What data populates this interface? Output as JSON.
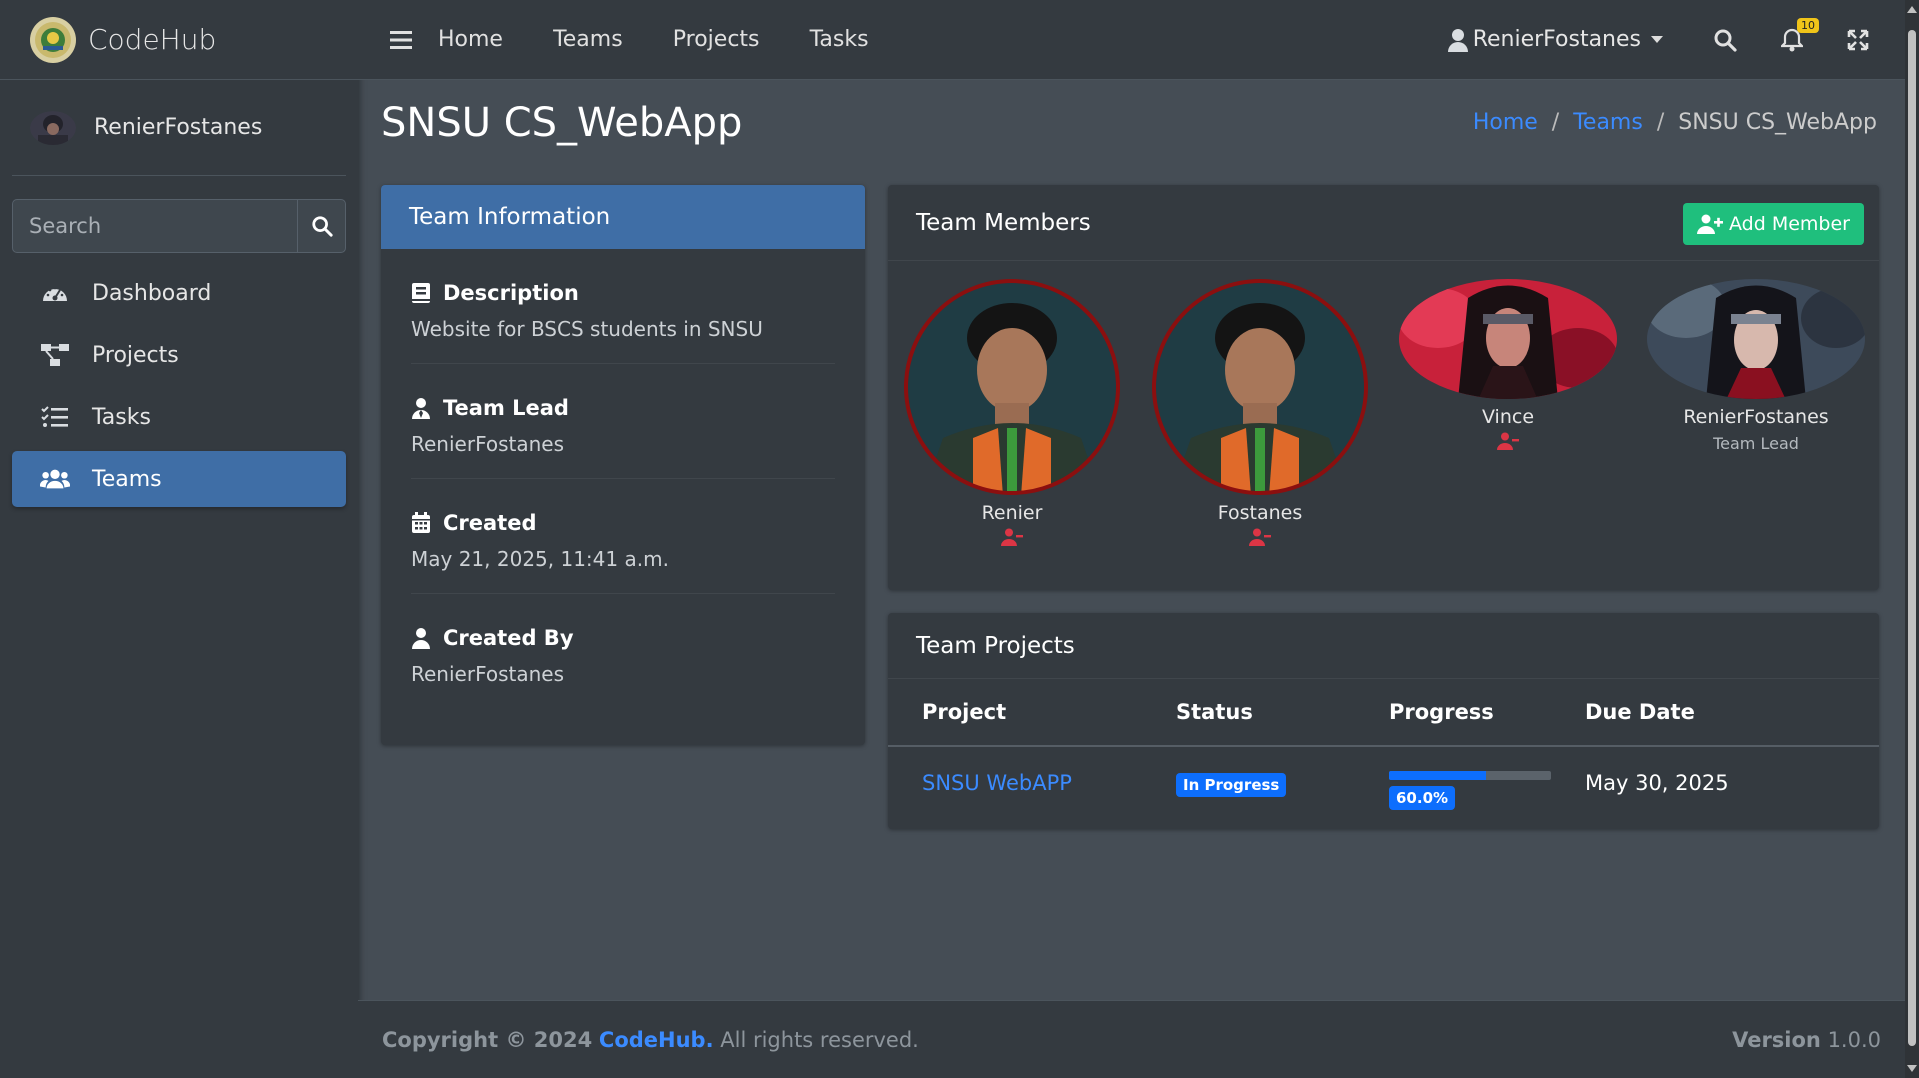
{
  "app": {
    "brand": "CodeHub",
    "user": "RenierFostanes"
  },
  "sidebar": {
    "search_placeholder": "Search",
    "items": [
      {
        "label": "Dashboard",
        "icon": "tachometer-icon"
      },
      {
        "label": "Projects",
        "icon": "project-diagram-icon"
      },
      {
        "label": "Tasks",
        "icon": "tasks-list-icon"
      },
      {
        "label": "Teams",
        "icon": "users-icon",
        "active": true
      }
    ]
  },
  "topbar": {
    "nav": [
      "Home",
      "Teams",
      "Projects",
      "Tasks"
    ],
    "user": "RenierFostanes",
    "notification_count": "10"
  },
  "page": {
    "title": "SNSU CS_WebApp",
    "breadcrumb": [
      "Home",
      "Teams",
      "SNSU CS_WebApp"
    ]
  },
  "team_info": {
    "header": "Team Information",
    "sections": [
      {
        "label": "Description",
        "value": "Website for BSCS students in SNSU"
      },
      {
        "label": "Team Lead",
        "value": "RenierFostanes"
      },
      {
        "label": "Created",
        "value": "May 21, 2025, 11:41 a.m."
      },
      {
        "label": "Created By",
        "value": "RenierFostanes"
      }
    ]
  },
  "team_members": {
    "header": "Team Members",
    "add_button": "Add Member",
    "members": [
      {
        "name": "Renier",
        "role": ""
      },
      {
        "name": "Fostanes",
        "role": ""
      },
      {
        "name": "Vince",
        "role": ""
      },
      {
        "name": "RenierFostanes",
        "role": "Team Lead"
      }
    ]
  },
  "team_projects": {
    "header": "Team Projects",
    "columns": [
      "Project",
      "Status",
      "Progress",
      "Due Date"
    ],
    "rows": [
      {
        "project": "SNSU WebAPP",
        "status": "In Progress",
        "progress": 60.0,
        "progress_label": "60.0%",
        "due": "May 30, 2025"
      }
    ]
  },
  "footer": {
    "copyright_prefix": "Copyright © 2024",
    "brand": "CodeHub.",
    "suffix": "All rights reserved.",
    "version_label": "Version",
    "version": "1.0.0"
  },
  "colors": {
    "accent": "#3f6ea6",
    "link": "#3b8bff",
    "success": "#1fbf7d",
    "primary": "#0d6efd"
  }
}
